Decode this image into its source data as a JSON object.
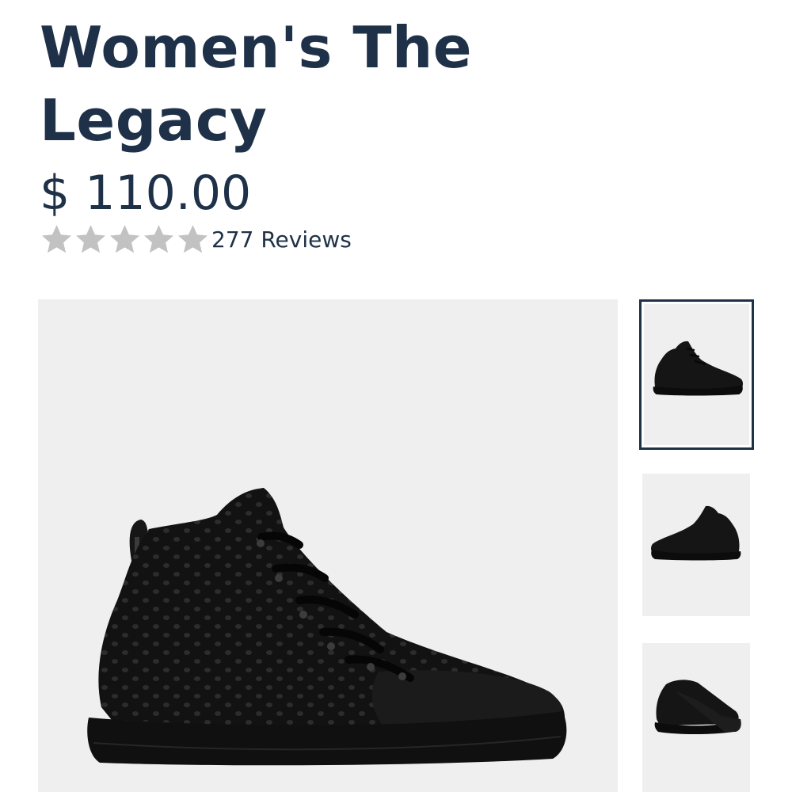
{
  "product": {
    "title": "Women's The Legacy",
    "price": "$ 110.00",
    "rating": {
      "stars": 5,
      "star_color": "#c2c2c2",
      "reviews_label": "277 Reviews"
    }
  },
  "gallery": {
    "main_image": "black-knit-high-top-sneaker-side-view",
    "background_color": "#efefef",
    "selected_border_color": "#1f3148",
    "thumbnails": [
      {
        "name": "sneaker-side-view",
        "selected": true
      },
      {
        "name": "sneaker-opposite-side-view",
        "selected": false
      },
      {
        "name": "sneaker-pair-front-view",
        "selected": false
      }
    ]
  },
  "colors": {
    "heading": "#1f3148",
    "background": "#ffffff"
  }
}
